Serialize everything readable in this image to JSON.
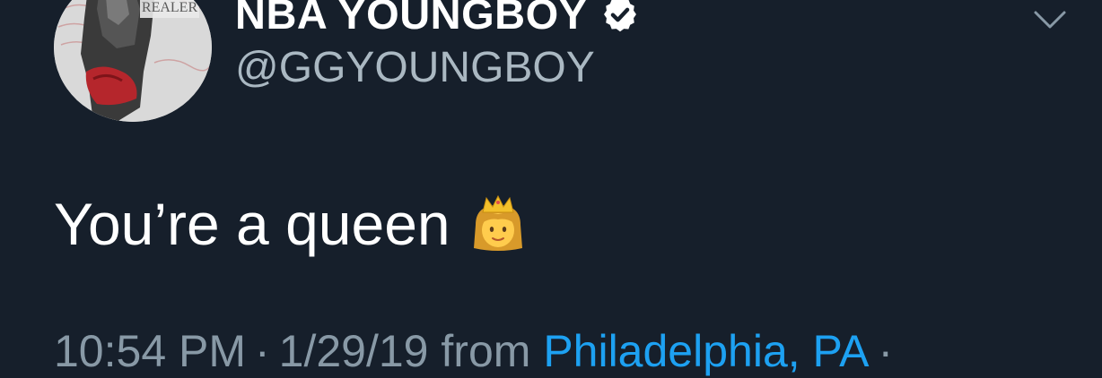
{
  "tweet": {
    "display_name": "NBA YOUNGBOY",
    "handle": "@GGYOUNGBOY",
    "verified": true,
    "text": "You’re a queen",
    "emoji": "princess",
    "time": "10:54 PM",
    "date": "1/29/19",
    "from_label": "from",
    "location": "Philadelphia, PA",
    "separator": "·"
  },
  "avatar": {
    "album_text": "REALER"
  },
  "colors": {
    "background": "#161f2b",
    "name": "#ffffff",
    "handle": "#aab8c2",
    "meta": "#8899a6",
    "link": "#1da1f2"
  },
  "icons": {
    "verified": "verified-badge-icon",
    "menu": "chevron-down-icon"
  }
}
